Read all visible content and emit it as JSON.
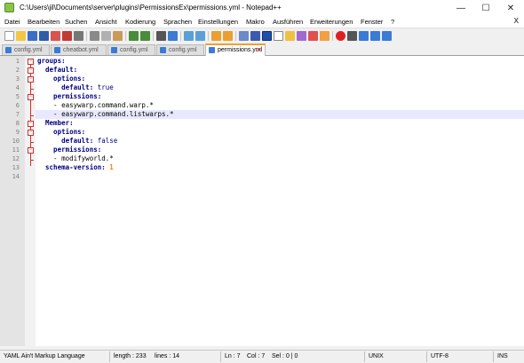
{
  "window": {
    "title": "C:\\Users\\jil\\Documents\\server\\plugins\\PermissionsEx\\permissions.yml - Notepad++",
    "minimize": "—",
    "maximize": "☐",
    "close": "✕"
  },
  "menu": {
    "items": [
      "Datei",
      "Bearbeiten",
      "Suchen",
      "Ansicht",
      "Kodierung",
      "Sprachen",
      "Einstellungen",
      "Makro",
      "Ausführen",
      "Erweiterungen",
      "Fenster",
      "?"
    ],
    "close": "X"
  },
  "tabs": [
    {
      "label": "config.yml",
      "active": false
    },
    {
      "label": "cheatbot.yml",
      "active": false
    },
    {
      "label": "config.yml",
      "active": false
    },
    {
      "label": "config.yml",
      "active": false
    },
    {
      "label": "permissions.yml",
      "active": true
    }
  ],
  "editor": {
    "current_line": 7,
    "lines": [
      {
        "num": "1",
        "text": "groups:"
      },
      {
        "num": "2",
        "text": "  default:"
      },
      {
        "num": "3",
        "text": "    options:"
      },
      {
        "num": "4",
        "text": "      default: true"
      },
      {
        "num": "5",
        "text": "    permissions:"
      },
      {
        "num": "6",
        "text": "    - easywarp.command.warp.*"
      },
      {
        "num": "7",
        "text": "    - easywarp.command.listwarps.*"
      },
      {
        "num": "8",
        "text": "  Member:"
      },
      {
        "num": "9",
        "text": "    options:"
      },
      {
        "num": "10",
        "text": "      default: false"
      },
      {
        "num": "11",
        "text": "    permissions:"
      },
      {
        "num": "12",
        "text": "    - modifyworld.*"
      },
      {
        "num": "13",
        "text": "  schema-version: 1"
      },
      {
        "num": "14",
        "text": ""
      }
    ]
  },
  "status": {
    "language": "YAML Ain't Markup Language",
    "length": "length : 233",
    "lines": "lines : 14",
    "ln": "Ln : 7",
    "col": "Col : 7",
    "sel": "Sel : 0 | 0",
    "eol": "UNIX",
    "encoding": "UTF-8",
    "mode": "INS"
  }
}
